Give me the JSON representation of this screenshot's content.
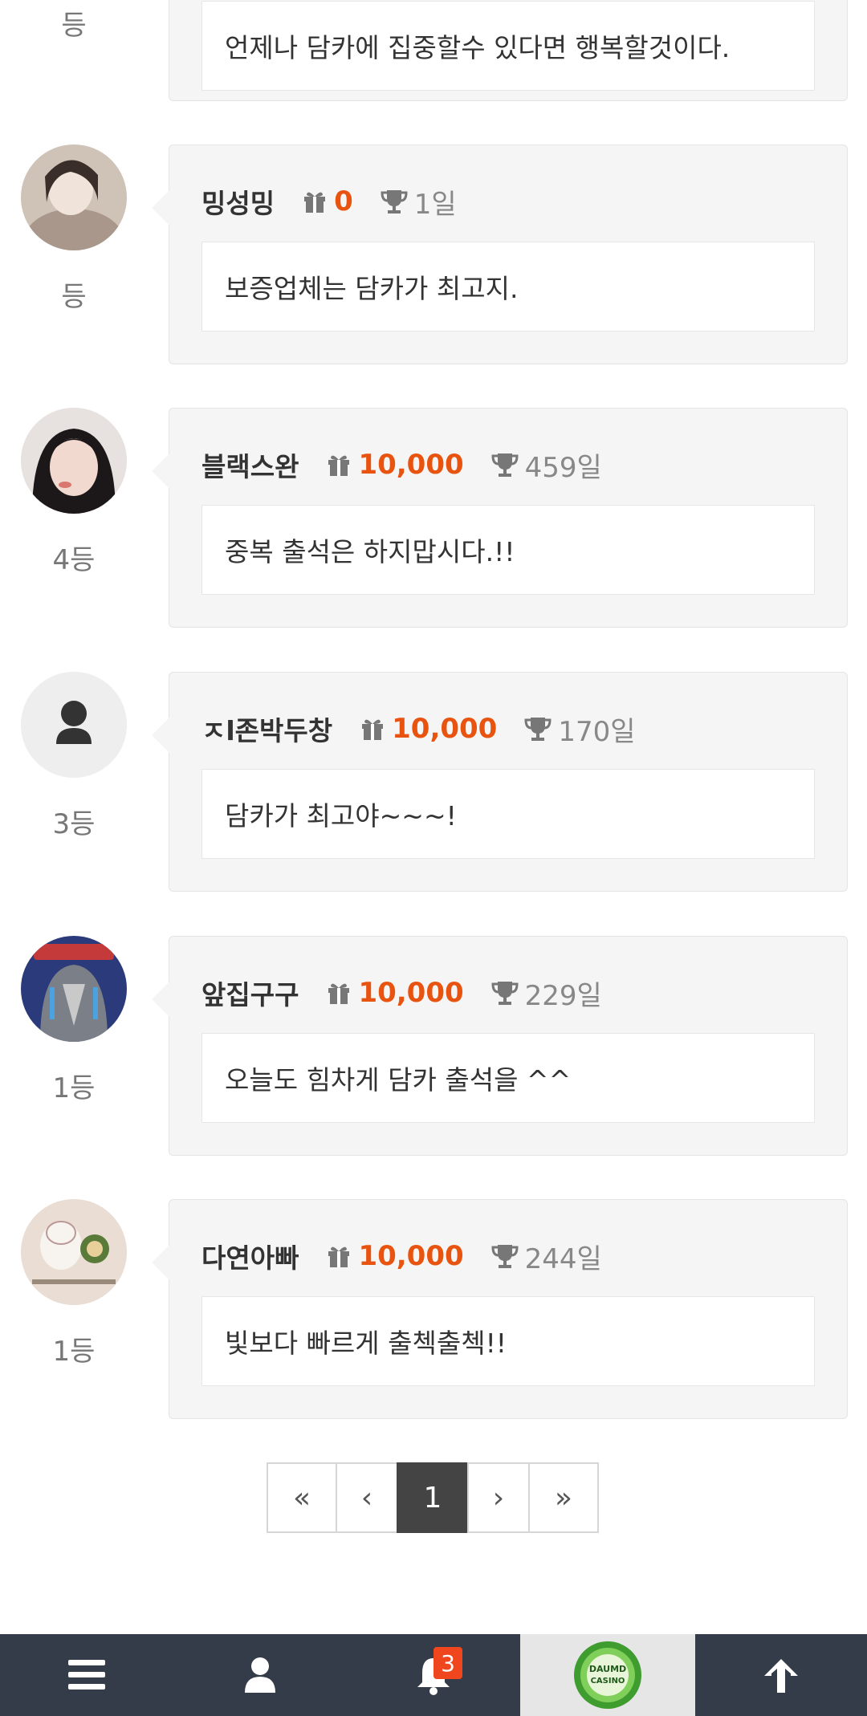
{
  "top_card": {
    "rank": "등",
    "comment": "언제나 담카에 집중할수 있다면 행복할것이다."
  },
  "entries": [
    {
      "rank": "등",
      "name": "밍성밍",
      "points": "0",
      "days": "1일",
      "comment": "보증업체는 담카가 최고지.",
      "avatar_icon": "photo-avatar"
    },
    {
      "rank": "4등",
      "name": "블랙스완",
      "points": "10,000",
      "days": "459일",
      "comment": "중복 출석은 하지맙시다.!!",
      "avatar_icon": "photo-avatar"
    },
    {
      "rank": "3등",
      "name": "ㅈl존박두창",
      "points": "10,000",
      "days": "170일",
      "comment": "담카가 최고야~~~!",
      "avatar_icon": "default-user-icon"
    },
    {
      "rank": "1등",
      "name": "앞집구구",
      "points": "10,000",
      "days": "229일",
      "comment": "오늘도 힘차게 담카 출석을 ^^",
      "avatar_icon": "photo-avatar"
    },
    {
      "rank": "1등",
      "name": "다연아빠",
      "points": "10,000",
      "days": "244일",
      "comment": "빛보다 빠르게 출첵출첵!!",
      "avatar_icon": "photo-avatar"
    }
  ],
  "pagination": {
    "first": "«",
    "prev": "‹",
    "current": "1",
    "next": "›",
    "last": "»"
  },
  "bottom_bar": {
    "notification_count": "3",
    "logo_text_1": "DAUMD",
    "logo_text_2": "CASINO"
  },
  "colors": {
    "points": "#e8540f",
    "bottom_bar": "#333c48",
    "badge": "#f0461e"
  }
}
